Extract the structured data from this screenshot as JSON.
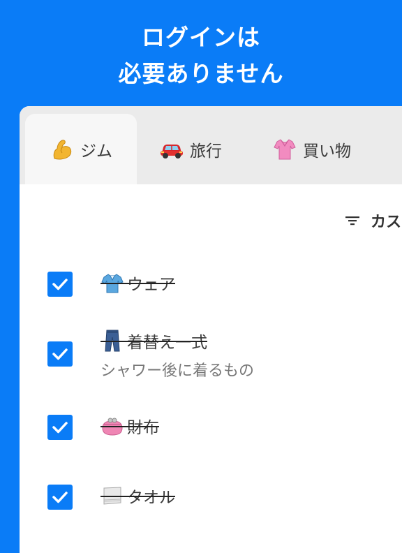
{
  "header": {
    "line1": "ログインは",
    "line2": "必要ありません"
  },
  "tabs": [
    {
      "label": "ジム",
      "icon": "flexed-biceps-icon",
      "active": true
    },
    {
      "label": "旅行",
      "icon": "car-icon",
      "active": false
    },
    {
      "label": "買い物",
      "icon": "blouse-icon",
      "active": false
    }
  ],
  "sort": {
    "label": "カス",
    "icon": "sort-filter-icon"
  },
  "items": [
    {
      "title": "ウェア",
      "icon": "polo-shirt-icon",
      "checked": true,
      "note": ""
    },
    {
      "title": "着替え一式",
      "icon": "jeans-icon",
      "checked": true,
      "note": "シャワー後に着るもの"
    },
    {
      "title": "財布",
      "icon": "purse-icon",
      "checked": true,
      "note": ""
    },
    {
      "title": "タオル",
      "icon": "towel-icon",
      "checked": true,
      "note": ""
    }
  ],
  "colors": {
    "accent": "#0a7cf7",
    "tab_bar": "#ebebeb",
    "active_tab": "#f7f7f7"
  }
}
